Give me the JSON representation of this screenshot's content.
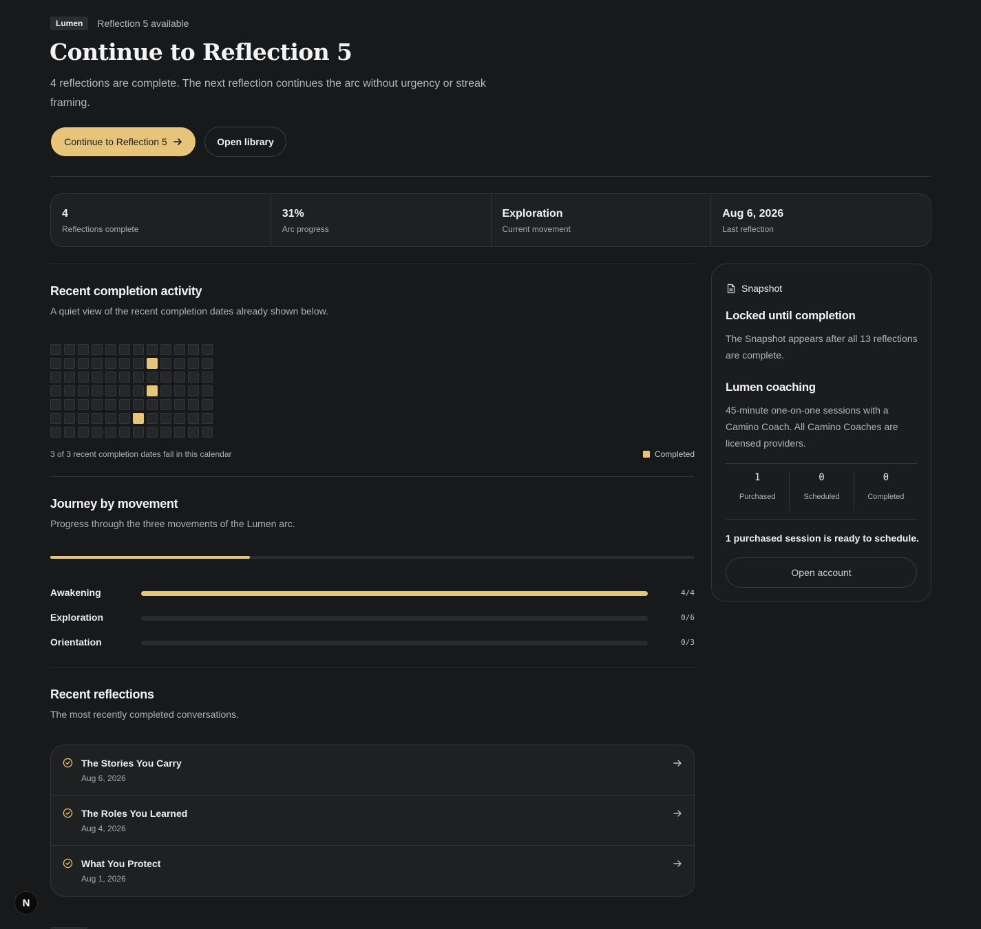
{
  "header": {
    "tag": "Lumen",
    "availability": "Reflection 5 available",
    "title": "Continue to Reflection 5",
    "lede": "4 reflections are complete. The next reflection continues the arc without urgency or streak framing.",
    "primary_button": "Continue to Reflection 5",
    "secondary_button": "Open library"
  },
  "stats": [
    {
      "value": "4",
      "label": "Reflections complete"
    },
    {
      "value": "31%",
      "label": "Arc progress"
    },
    {
      "value": "Exploration",
      "label": "Current movement"
    },
    {
      "value": "Aug 6, 2026",
      "label": "Last reflection"
    }
  ],
  "activity": {
    "title": "Recent completion activity",
    "subtitle": "A quiet view of the recent completion dates already shown below.",
    "calendar_rows": 7,
    "calendar_cols": 12,
    "completed_cells": [
      [
        1,
        7
      ],
      [
        3,
        7
      ],
      [
        5,
        6
      ]
    ],
    "note": "3 of 3 recent completion dates fall in this calendar",
    "legend": "Completed"
  },
  "journey": {
    "title": "Journey by movement",
    "subtitle": "Progress through the three movements of the Lumen arc.",
    "overall_progress": 0.31,
    "movements": [
      {
        "name": "Awakening",
        "done": 4,
        "total": 4,
        "count": "4/4"
      },
      {
        "name": "Exploration",
        "done": 0,
        "total": 6,
        "count": "0/6"
      },
      {
        "name": "Orientation",
        "done": 0,
        "total": 3,
        "count": "0/3"
      }
    ]
  },
  "recent": {
    "title": "Recent reflections",
    "subtitle": "The most recently completed conversations.",
    "items": [
      {
        "title": "The Stories You Carry",
        "date": "Aug 6, 2026"
      },
      {
        "title": "The Roles You Learned",
        "date": "Aug 4, 2026"
      },
      {
        "title": "What You Protect",
        "date": "Aug 1, 2026"
      }
    ]
  },
  "card": {
    "label": "Snapshot",
    "snapshot_title": "Locked until completion",
    "snapshot_text": "The Snapshot appears after all 13 reflections are complete.",
    "coaching_title": "Lumen coaching",
    "coaching_text": "45-minute one-on-one sessions with a Camino Coach. All Camino Coaches are licensed providers.",
    "counts": [
      {
        "value": "1",
        "label": "Purchased"
      },
      {
        "value": "0",
        "label": "Scheduled"
      },
      {
        "value": "0",
        "label": "Completed"
      }
    ],
    "ready_text": "1 purchased session is ready to schedule.",
    "account_button": "Open account"
  },
  "badge": "N",
  "colors": {
    "accent": "#e6c57b",
    "background": "#18191b",
    "surface": "#1f2022",
    "border": "#34353a"
  }
}
